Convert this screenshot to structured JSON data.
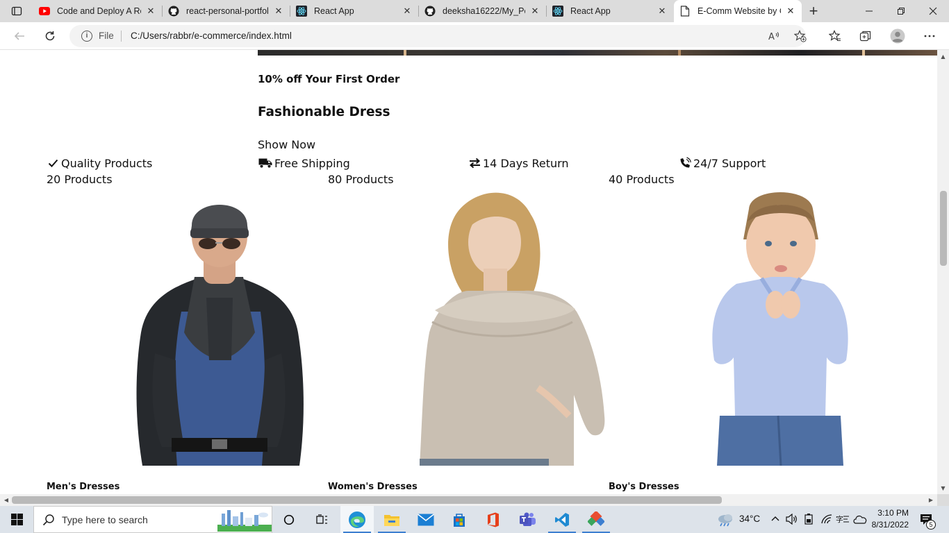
{
  "browser": {
    "tabs": [
      {
        "title": "Code and Deploy A Re",
        "icon": "youtube-icon",
        "active": false
      },
      {
        "title": "react-personal-portfol",
        "icon": "github-icon",
        "active": false
      },
      {
        "title": "React App",
        "icon": "react-icon",
        "active": false
      },
      {
        "title": "deeksha16222/My_Po",
        "icon": "github-icon",
        "active": false
      },
      {
        "title": "React App",
        "icon": "react-icon",
        "active": false
      },
      {
        "title": "E-Comm Website by C",
        "icon": "page-icon",
        "active": true
      }
    ],
    "address": {
      "scheme_label": "File",
      "url": "C:/Users/rabbr/e-commerce/index.html"
    }
  },
  "page": {
    "hero": {
      "offer": "10% off Your First Order",
      "title": "Fashionable Dress",
      "cta": "Show Now"
    },
    "features": [
      {
        "label": "Quality Products",
        "icon": "check-icon"
      },
      {
        "label": "Free Shipping",
        "icon": "truck-icon"
      },
      {
        "label": "14 Days Return",
        "icon": "exchange-icon"
      },
      {
        "label": "24/7 Support",
        "icon": "phone-volume-icon"
      }
    ],
    "categories": [
      {
        "count": "20 Products",
        "name": "Men's Dresses",
        "image": "man-leather-jacket-photo"
      },
      {
        "count": "80 Products",
        "name": "Women's Dresses",
        "image": "woman-sweater-photo"
      },
      {
        "count": "40 Products",
        "name": "Boy's Dresses",
        "image": "boy-shirt-photo"
      }
    ]
  },
  "taskbar": {
    "search_placeholder": "Type here to search",
    "weather": "34°C",
    "time": "3:10 PM",
    "date": "8/31/2022",
    "notifications": "5",
    "colors": {
      "accent": "#3d7fd0",
      "background": "#dde3ea"
    }
  }
}
